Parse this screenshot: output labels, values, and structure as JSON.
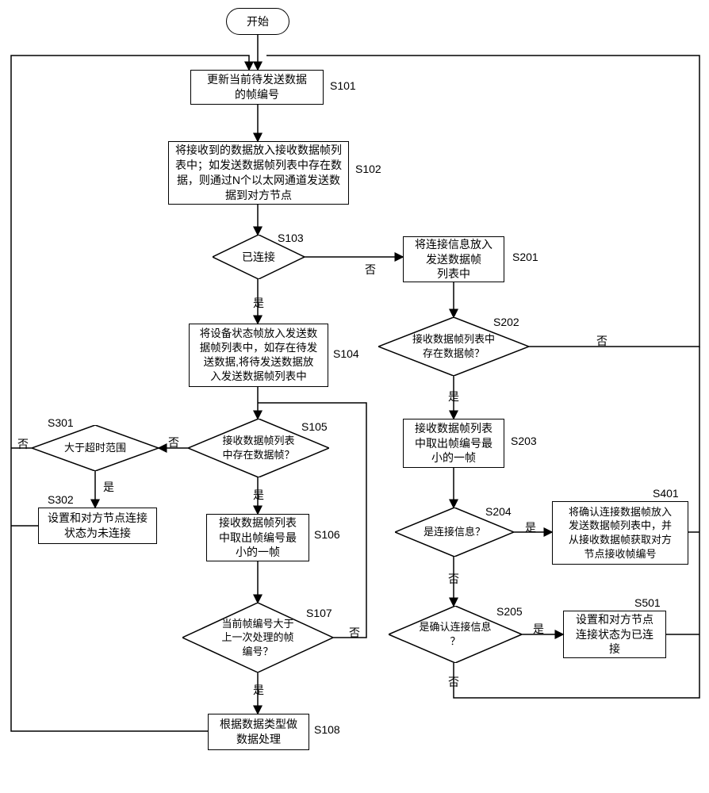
{
  "chart_data": {
    "type": "flowchart",
    "nodes": [
      {
        "id": "start",
        "type": "terminator",
        "text": "开始",
        "label": ""
      },
      {
        "id": "s101",
        "type": "process",
        "text": "更新当前待发送数据的帧编号",
        "label": "S101"
      },
      {
        "id": "s102",
        "type": "process",
        "text": "将接收到的数据放入接收数据帧列表中；如发送数据帧列表中存在数据，则通过N个以太网通道发送数据到对方节点",
        "label": "S102"
      },
      {
        "id": "s103",
        "type": "decision",
        "text": "已连接",
        "label": "S103"
      },
      {
        "id": "s104",
        "type": "process",
        "text": "将设备状态帧放入发送数据帧列表中，如存在待发送数据，将待发送数据放入发送数据帧列表中",
        "label": "S104"
      },
      {
        "id": "s105",
        "type": "decision",
        "text": "接收数据帧列表中存在数据帧？",
        "label": "S105"
      },
      {
        "id": "s106",
        "type": "process",
        "text": "接收数据帧列表中取出帧编号最小的一帧",
        "label": "S106"
      },
      {
        "id": "s107",
        "type": "decision",
        "text": "当前帧编号大于上一次处理的帧编号？",
        "label": "S107"
      },
      {
        "id": "s108",
        "type": "process",
        "text": "根据数据类型做数据处理",
        "label": "S108"
      },
      {
        "id": "s201",
        "type": "process",
        "text": "将连接信息放入发送数据帧列表中",
        "label": "S201"
      },
      {
        "id": "s202",
        "type": "decision",
        "text": "接收数据帧列表中存在数据帧？",
        "label": "S202"
      },
      {
        "id": "s203",
        "type": "process",
        "text": "接收数据帧列表中取出帧编号最小的一帧",
        "label": "S203"
      },
      {
        "id": "s204",
        "type": "decision",
        "text": "是连接信息？",
        "label": "S204"
      },
      {
        "id": "s205",
        "type": "decision",
        "text": "是确认连接信息？",
        "label": "S205"
      },
      {
        "id": "s301",
        "type": "decision",
        "text": "大于超时范围",
        "label": "S301"
      },
      {
        "id": "s302",
        "type": "process",
        "text": "设置和对方节点连接状态为未连接",
        "label": "S302"
      },
      {
        "id": "s401",
        "type": "process",
        "text": "将确认连接数据帧放入发送数据帧列表中，并从接收数据帧获取对方节点接收帧编号",
        "label": "S401"
      },
      {
        "id": "s501",
        "type": "process",
        "text": "设置和对方节点连接状态为已连接",
        "label": "S501"
      }
    ],
    "edge_labels": {
      "yes": "是",
      "no": "否"
    }
  },
  "terminator": {
    "start": "开始"
  },
  "steps": {
    "s101": "更新当前待发送数据\n的帧编号",
    "s102": "将接收到的数据放入接收数据帧列\n表中；如发送数据帧列表中存在数\n据，则通过N个以太网通道发送数\n据到对方节点",
    "s103": "已连接",
    "s104": "将设备状态帧放入发送数\n据帧列表中，如存在待发\n送数据,将待发送数据放\n入发送数据帧列表中",
    "s105": "接收数据帧列表\n中存在数据帧？",
    "s106": "接收数据帧列表\n中取出帧编号最\n小的一帧",
    "s107": "当前帧编号大于\n上一次处理的帧\n编号？",
    "s108": "根据数据类型做\n数据处理",
    "s201": "将连接信息放入\n发送数据帧\n列表中",
    "s202": "接收数据帧列表中\n存在数据帧？",
    "s203": "接收数据帧列表\n中取出帧编号最\n小的一帧",
    "s204": "是连接信息？",
    "s205": "是确认连接信息\n？",
    "s301": "大于超时范围",
    "s302": "设置和对方节点连接\n状态为未连接",
    "s401": "将确认连接数据帧放入\n发送数据帧列表中，并\n从接收数据帧获取对方\n节点接收帧编号",
    "s501": "设置和对方节点\n连接状态为已连\n接"
  },
  "labels": {
    "s101": "S101",
    "s102": "S102",
    "s103": "S103",
    "s104": "S104",
    "s105": "S105",
    "s106": "S106",
    "s107": "S107",
    "s108": "S108",
    "s201": "S201",
    "s202": "S202",
    "s203": "S203",
    "s204": "S204",
    "s205": "S205",
    "s301": "S301",
    "s302": "S302",
    "s401": "S401",
    "s501": "S501"
  },
  "edge": {
    "yes": "是",
    "no": "否"
  }
}
